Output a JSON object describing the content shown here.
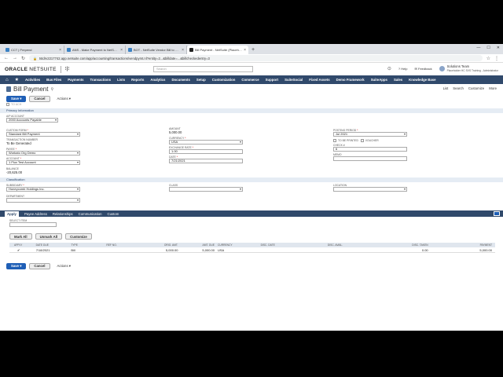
{
  "browser": {
    "tabs": [
      {
        "label": "CCT | Prepend",
        "active": false
      },
      {
        "label": "ANS - Make Payment to NetSuite ...",
        "active": false
      },
      {
        "label": "BOT - NetSuite Vendor Bill to Pa...",
        "active": false
      },
      {
        "label": "Bill Payment - NetSuite (Placeholde...",
        "active": true
      }
    ],
    "url": "tstdrv2217742.app.netsuite.com/app/accounting/transactions/vendpymt.nl?entity=2...&billdate=...&billcheckedentry=3"
  },
  "header": {
    "logo": "ORACLE",
    "logo_suffix": "NETSUITE",
    "search_placeholder": "Search",
    "help": "Help",
    "feedback": "Feedback",
    "user_name": "Solutions Team",
    "user_role": "Placeholder HC SVS Training - Administrator"
  },
  "nav": [
    "Activities",
    "Bus Files",
    "Payments",
    "Transactions",
    "Lists",
    "Reports",
    "Analytics",
    "Documents",
    "Setup",
    "Customization",
    "Commerce",
    "Support",
    "SuiteSocial",
    "Fixed Assets",
    "Demo Framework",
    "SuiteApps",
    "Sales",
    "Knowledge Base"
  ],
  "page": {
    "title": "Bill Payment",
    "links": [
      "List",
      "Search",
      "Customize",
      "More"
    ],
    "save": "Save",
    "cancel": "Cancel",
    "actions": "Actions ▾",
    "ach_label": "To ACH"
  },
  "primary": {
    "section": "Primary Information",
    "ap_account_label": "A/P Account",
    "ap_account": "2000 Accounts Payable",
    "custom_form_label": "Custom Form",
    "custom_form": "Standard Bill Payment",
    "tran_no_label": "Transaction Number",
    "tran_no": "To Be Generated",
    "payee_label": "Payee",
    "payee": "Workato Org Demo",
    "account_label": "Account",
    "account": "1 Flux Test Account",
    "balance_label": "Balance",
    "balance": "-20,625.00",
    "amount_label": "Amount",
    "amount": "5,000.00",
    "currency_label": "Currency",
    "currency": "USA",
    "exchange_label": "Exchange Rate",
    "exchange": "1.00",
    "date_label": "Date",
    "date": "7/21/2021",
    "posting_label": "Posting Period",
    "posting": "Jul 2021",
    "to_be_printed": "To Be Printed",
    "voucher": "Voucher",
    "check_label": "Check #",
    "check": "6",
    "memo_label": "Memo"
  },
  "classification": {
    "section": "Classification",
    "subsidiary_label": "Subsidiary",
    "subsidiary": "Honeycomb Holdings Inc.",
    "department_label": "Department",
    "class_label": "Class",
    "location_label": "Location"
  },
  "sublist": {
    "tabs": [
      "Apply",
      "Payee Address",
      "Relationships",
      "Communication",
      "Custom"
    ],
    "select_item_label": "Select Item",
    "mark_all": "Mark All",
    "unmark_all": "Unmark All",
    "customize": "Customize",
    "columns": [
      "Apply",
      "Date Due",
      "Type",
      "Ref No.",
      "Orig. Amt.",
      "Amt. Due",
      "Currency",
      "Disc. Date",
      "Disc. Avail.",
      "Disc. Taken",
      "Payment"
    ],
    "rows": [
      {
        "apply": "✔",
        "date_due": "7/18/2021",
        "type": "Bill",
        "ref": "",
        "orig": "5,000.00",
        "due": "5,000.00",
        "currency": "USA",
        "disc_date": "",
        "disc_avail": "",
        "disc_taken": "0.00",
        "payment": "5,000.00"
      }
    ]
  }
}
